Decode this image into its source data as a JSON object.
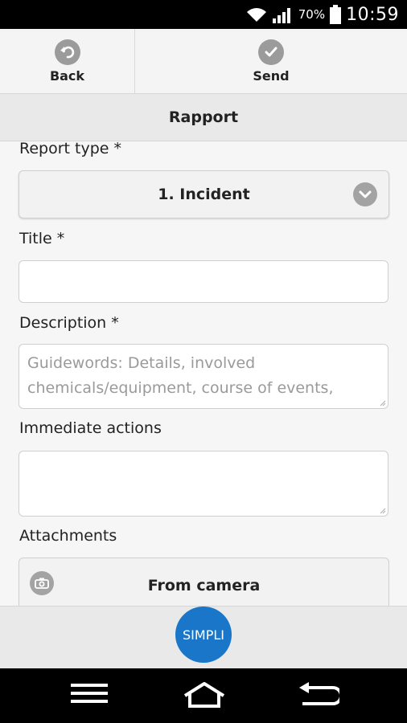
{
  "status_bar": {
    "battery": "70%",
    "time": "10:59"
  },
  "toolbar": {
    "back_label": "Back",
    "send_label": "Send"
  },
  "page": {
    "title": "Rapport"
  },
  "form": {
    "report_type": {
      "label": "Report type *",
      "value": "1. Incident"
    },
    "title": {
      "label": "Title *",
      "value": ""
    },
    "description": {
      "label": "Description *",
      "placeholder": "Guidewords: Details, involved chemicals/equipment, course of events,",
      "value": ""
    },
    "immediate_actions": {
      "label": "Immediate actions",
      "value": ""
    },
    "attachments": {
      "label": "Attachments",
      "camera_label": "From camera"
    }
  },
  "footer": {
    "logo_text": "SIMPLI"
  },
  "colors": {
    "accent": "#1976c9",
    "icon_gray": "#9b9b9b"
  }
}
